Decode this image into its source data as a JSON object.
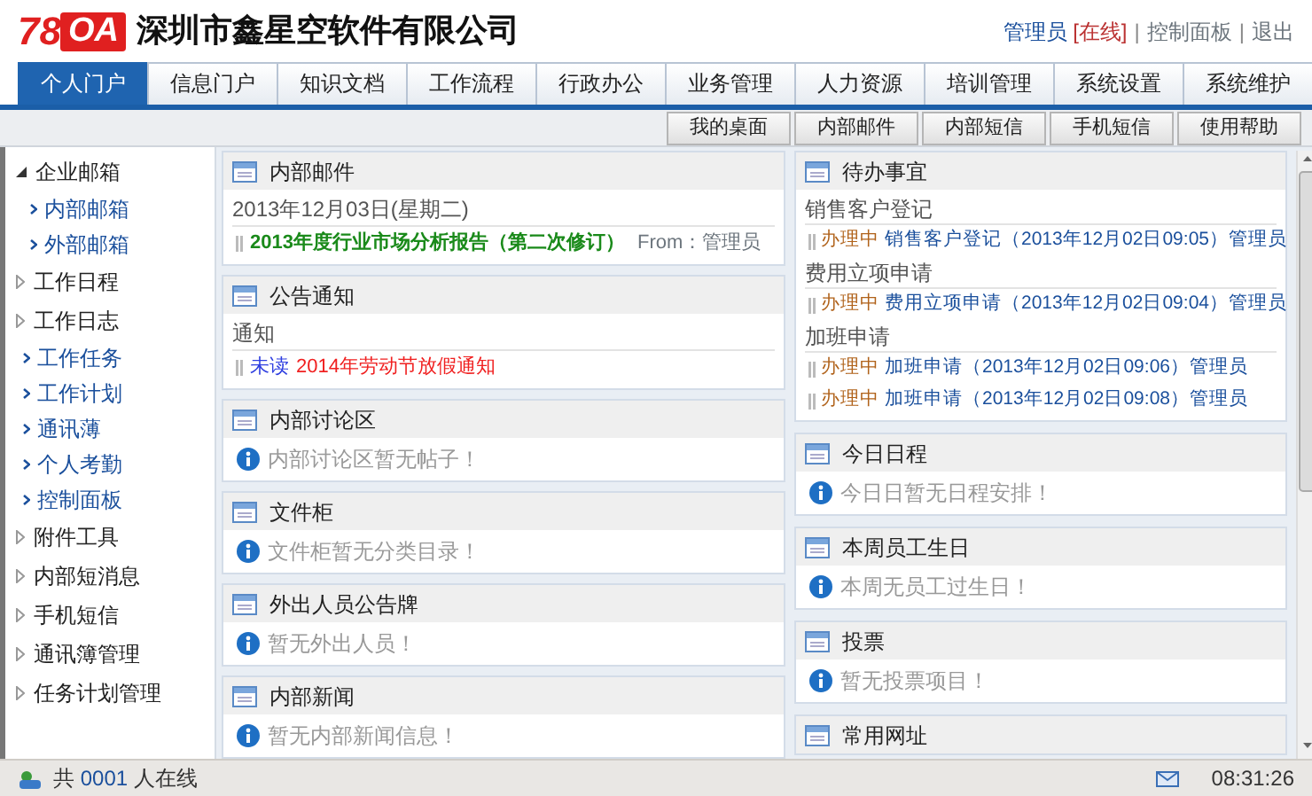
{
  "header": {
    "logo": {
      "number": "78",
      "letters": "OA"
    },
    "company": "深圳市鑫星空软件有限公司",
    "user": "管理员",
    "status": "[在线]",
    "links": [
      {
        "separator": "|",
        "label": "控制面板"
      },
      {
        "separator": "|",
        "label": "退出"
      }
    ]
  },
  "tabs": [
    {
      "label": "个人门户",
      "selected": true
    },
    {
      "label": "信息门户",
      "selected": false
    },
    {
      "label": "知识文档",
      "selected": false
    },
    {
      "label": "工作流程",
      "selected": false
    },
    {
      "label": "行政办公",
      "selected": false
    },
    {
      "label": "业务管理",
      "selected": false
    },
    {
      "label": "人力资源",
      "selected": false
    },
    {
      "label": "培训管理",
      "selected": false
    },
    {
      "label": "系统设置",
      "selected": false
    },
    {
      "label": "系统维护",
      "selected": false
    }
  ],
  "toolbar": [
    "我的桌面",
    "内部邮件",
    "内部短信",
    "手机短信",
    "使用帮助"
  ],
  "sidebar": {
    "items": [
      {
        "label": "企业邮箱",
        "kind": "group",
        "expanded": true,
        "children": [
          {
            "label": "内部邮箱"
          },
          {
            "label": "外部邮箱"
          }
        ]
      },
      {
        "label": "工作日程",
        "kind": "group",
        "expanded": false
      },
      {
        "label": "工作日志",
        "kind": "group",
        "expanded": false
      },
      {
        "label": "工作任务",
        "kind": "link"
      },
      {
        "label": "工作计划",
        "kind": "link"
      },
      {
        "label": "通讯薄",
        "kind": "link"
      },
      {
        "label": "个人考勤",
        "kind": "link"
      },
      {
        "label": "控制面板",
        "kind": "link"
      },
      {
        "label": "附件工具",
        "kind": "group",
        "expanded": false
      },
      {
        "label": "内部短消息",
        "kind": "group",
        "expanded": false
      },
      {
        "label": "手机短信",
        "kind": "group",
        "expanded": false
      },
      {
        "label": "通讯簿管理",
        "kind": "group",
        "expanded": false
      },
      {
        "label": "任务计划管理",
        "kind": "group",
        "expanded": false
      }
    ]
  },
  "left_panels": [
    {
      "title": "内部邮件",
      "kind": "mail",
      "date": "2013年12月03日(星期二)",
      "items": [
        {
          "subject": "2013年度行业市场分析报告（第二次修订）",
          "from": "From：管理员"
        }
      ]
    },
    {
      "title": "公告通知",
      "kind": "notice",
      "category": "通知",
      "items": [
        {
          "status": "未读",
          "title": "2014年劳动节放假通知"
        }
      ]
    },
    {
      "title": "内部讨论区",
      "kind": "empty",
      "message": "内部讨论区暂无帖子！"
    },
    {
      "title": "文件柜",
      "kind": "empty",
      "message": "文件柜暂无分类目录！"
    },
    {
      "title": "外出人员公告牌",
      "kind": "empty",
      "message": "暂无外出人员！"
    },
    {
      "title": "内部新闻",
      "kind": "empty",
      "message": "暂无内部新闻信息！"
    }
  ],
  "right_panels": [
    {
      "title": "待办事宜",
      "kind": "todo",
      "groups": [
        {
          "category": "销售客户登记",
          "items": [
            {
              "status": "办理中",
              "text": "销售客户登记（2013年12月02日09:05）管理员"
            }
          ]
        },
        {
          "category": "费用立项申请",
          "items": [
            {
              "status": "办理中",
              "text": "费用立项申请（2013年12月02日09:04）管理员"
            }
          ]
        },
        {
          "category": "加班申请",
          "items": [
            {
              "status": "办理中",
              "text": "加班申请（2013年12月02日09:06）管理员"
            },
            {
              "status": "办理中",
              "text": "加班申请（2013年12月02日09:08）管理员"
            }
          ]
        }
      ]
    },
    {
      "title": "今日日程",
      "kind": "empty",
      "message": "今日日暂无日程安排！"
    },
    {
      "title": "本周员工生日",
      "kind": "empty",
      "message": "本周无员工过生日！"
    },
    {
      "title": "投票",
      "kind": "empty",
      "message": "暂无投票项目！"
    },
    {
      "title": "常用网址",
      "kind": "empty"
    }
  ],
  "status_bar": {
    "online_prefix": "共",
    "online_count": "0001",
    "online_suffix": "人在线",
    "time": "08:31:26"
  }
}
